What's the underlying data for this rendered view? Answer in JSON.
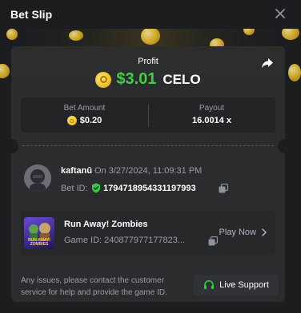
{
  "header": {
    "title": "Bet Slip"
  },
  "profit": {
    "label": "Profit",
    "amount": "$3.01",
    "currency": "CELO"
  },
  "bet": {
    "amount_label": "Bet Amount",
    "amount_value": "$0.20",
    "payout_label": "Payout",
    "payout_value": "16.0014 x"
  },
  "user": {
    "name": "kaftanû",
    "datetime": "On 3/27/2024, 11:09:31 PM",
    "bet_id_label": "Bet ID:",
    "bet_id_value": "1794718954331197993"
  },
  "game": {
    "thumb_caption": "RUN AWAY! ZOMBIES",
    "name": "Run Away! Zombies",
    "id_label": "Game ID:",
    "id_value": "240877977177823...",
    "play_label": "Play Now"
  },
  "footer": {
    "text": "Any issues, please contact the customer service for help and provide the game ID.",
    "support_label": "Live Support"
  },
  "colors": {
    "profit_green": "#3dd23d",
    "coin_gold": "#f4c430",
    "shield_green": "#2ecc40",
    "background": "#1b1d21",
    "card": "#2a2c30"
  },
  "icons": [
    "close-icon",
    "share-icon",
    "coin-icon",
    "shield-icon",
    "copy-icon",
    "chevron-right-icon",
    "headset-icon"
  ]
}
